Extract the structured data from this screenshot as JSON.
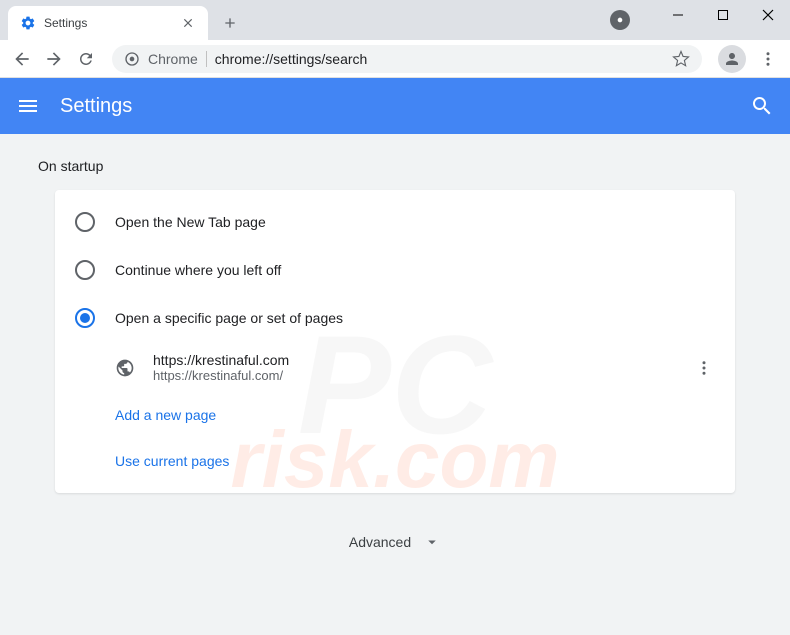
{
  "tab": {
    "title": "Settings"
  },
  "omnibox": {
    "label": "Chrome",
    "url": "chrome://settings/search"
  },
  "header": {
    "title": "Settings"
  },
  "section": {
    "title": "On startup"
  },
  "radios": {
    "newtab": "Open the New Tab page",
    "continue": "Continue where you left off",
    "specific": "Open a specific page or set of pages"
  },
  "page": {
    "title": "https://krestinaful.com",
    "url": "https://krestinaful.com/"
  },
  "links": {
    "add": "Add a new page",
    "current": "Use current pages"
  },
  "advanced": "Advanced"
}
